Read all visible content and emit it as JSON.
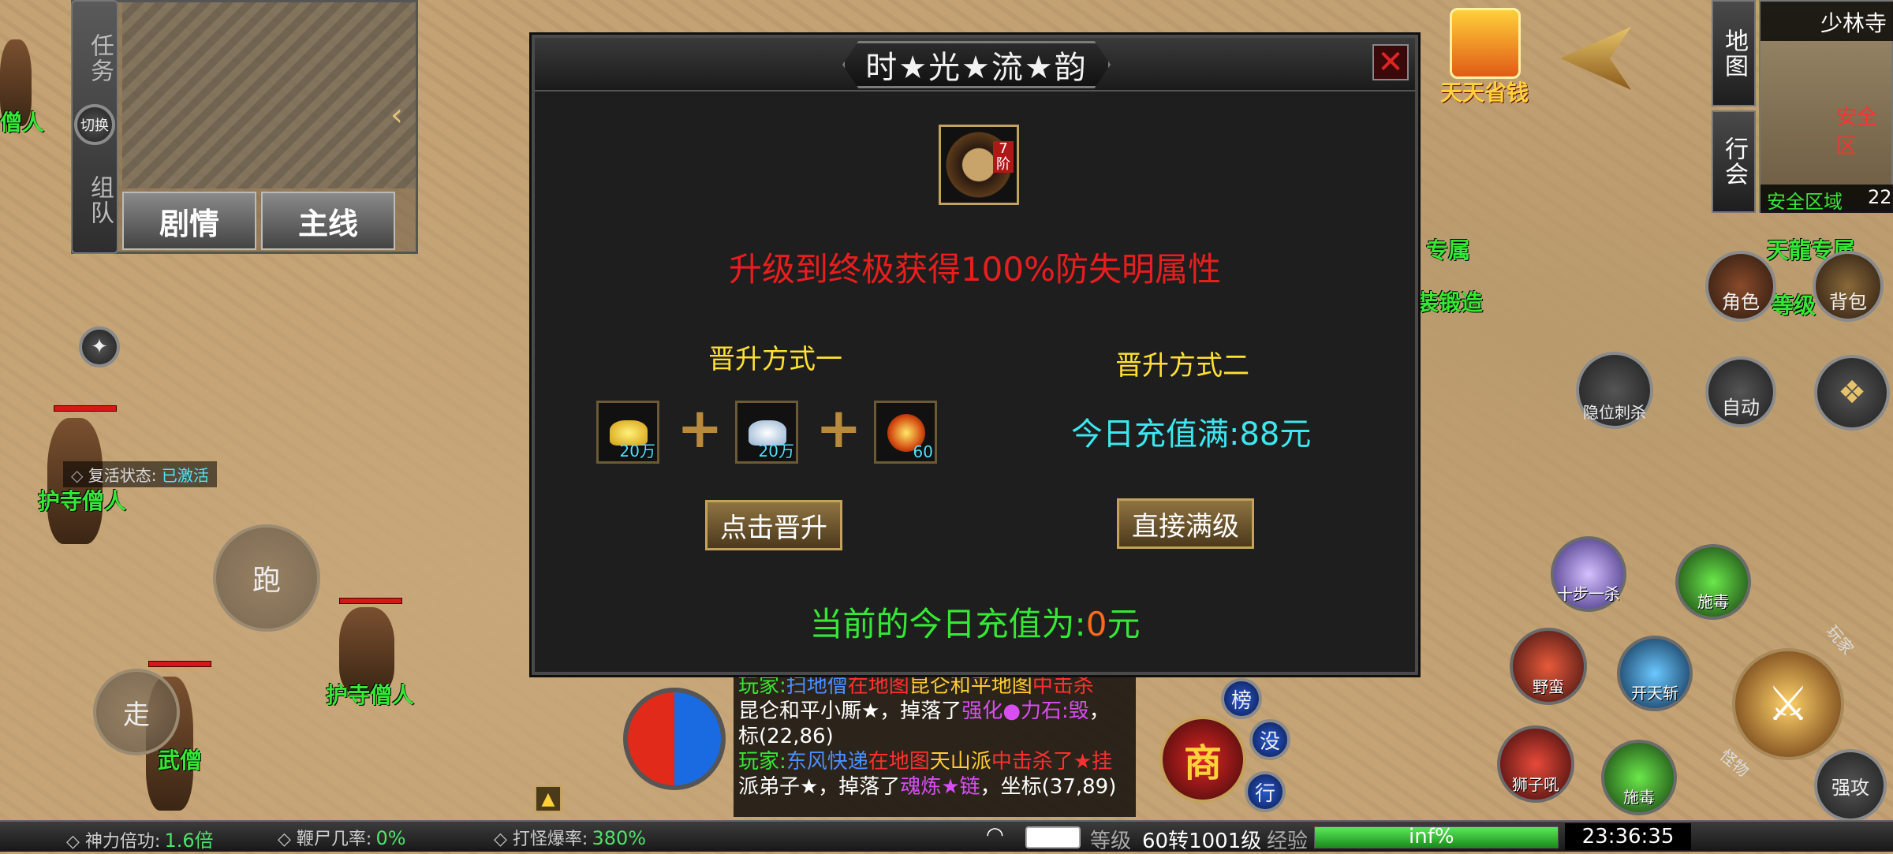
{
  "map": {
    "location_name": "少林寺",
    "map_btn_label": "地图",
    "guild_btn_label": "行会",
    "minimap_label": "安全区域",
    "minimap_coord": "22",
    "safe_zone_text": "安全区"
  },
  "quest_panel": {
    "task_label": "任务",
    "switch_label": "切换",
    "team_label": "组队",
    "tab_story": "剧情",
    "tab_main": "主线"
  },
  "gift": {
    "label": "天天省钱"
  },
  "dialog": {
    "title": "时★光★流★韵",
    "item_badge": "7阶",
    "headline": "升级到终极获得100%防失明属性",
    "method_one_title": "晋升方式一",
    "method_two_title": "晋升方式二",
    "materials": [
      {
        "name": "gold-ingot",
        "count": "20万"
      },
      {
        "name": "silver-ingot",
        "count": "20万"
      },
      {
        "name": "orb",
        "count": "60"
      }
    ],
    "recharge_prefix": "今日充值满:",
    "recharge_amount": "88元",
    "upgrade_btn": "点击晋升",
    "max_btn": "直接满级",
    "current_prefix": "当前的今日充值为:",
    "current_value": "0",
    "current_suffix": "元"
  },
  "world": {
    "npc_names": [
      "护寺僧人",
      "护寺僧人",
      "武僧",
      "僧人"
    ],
    "revive_label": "复活状态:",
    "revive_value": "已激活",
    "run_label": "跑",
    "walk_label": "走",
    "exclusive_left_top": "专属",
    "exclusive_left_bottom": "装锻造",
    "exclusive_right_top": "天龍专属",
    "exclusive_right_bottom": "等级"
  },
  "right_controls": {
    "role_label": "角色",
    "bag_label": "背包",
    "stealth_label": "隐位刺杀",
    "auto_label": "自动",
    "skills": [
      "十步一杀",
      "施毒",
      "野蛮",
      "开天斩",
      "狮子吼",
      "施毒"
    ],
    "strong_attack": "强攻",
    "side_labels": [
      "玩家",
      "怪物"
    ]
  },
  "menu_buttons": {
    "rank": "榜",
    "shop": "商",
    "none": "没",
    "walk": "行"
  },
  "chat": {
    "lines": [
      {
        "parts": [
          {
            "t": "玩家:",
            "c": "#35e835"
          },
          {
            "t": "扫地僧",
            "c": "#4a8fff"
          },
          {
            "t": "在地图",
            "c": "#ff3030"
          },
          {
            "t": "昆仑和平地图",
            "c": "#ffcc33"
          },
          {
            "t": "中击杀",
            "c": "#ff3030"
          }
        ]
      },
      {
        "parts": [
          {
            "t": "昆仑和平小厮★，掉落了",
            "c": "#ffffff"
          },
          {
            "t": "强化●力石:毁",
            "c": "#d84ef2"
          },
          {
            "t": "，",
            "c": "#ffffff"
          }
        ]
      },
      {
        "parts": [
          {
            "t": "标(22,86)",
            "c": "#ffffff"
          }
        ]
      },
      {
        "parts": [
          {
            "t": "玩家:",
            "c": "#35e835"
          },
          {
            "t": "东风快递",
            "c": "#4a8fff"
          },
          {
            "t": "在地图",
            "c": "#ff3030"
          },
          {
            "t": "天山派",
            "c": "#ffcc33"
          },
          {
            "t": "中击杀了★挂",
            "c": "#ff3030"
          }
        ]
      },
      {
        "parts": [
          {
            "t": "派弟子★，掉落了",
            "c": "#ffffff"
          },
          {
            "t": "魂炼★链",
            "c": "#d84ef2"
          },
          {
            "t": "，坐标(37,89)",
            "c": "#ffffff"
          }
        ]
      }
    ]
  },
  "bottom_bar": {
    "power_label": "神力倍功:",
    "power_value": "1.6倍",
    "corpse_label": "鞭尸几率:",
    "corpse_value": "0%",
    "drop_label": "打怪爆率:",
    "drop_value": "380%",
    "level_label": "等级",
    "level_value": "60转1001级",
    "exp_label": "经验",
    "exp_value": "inf%",
    "exp_fill": 1.0,
    "clock": "23:36:35"
  }
}
